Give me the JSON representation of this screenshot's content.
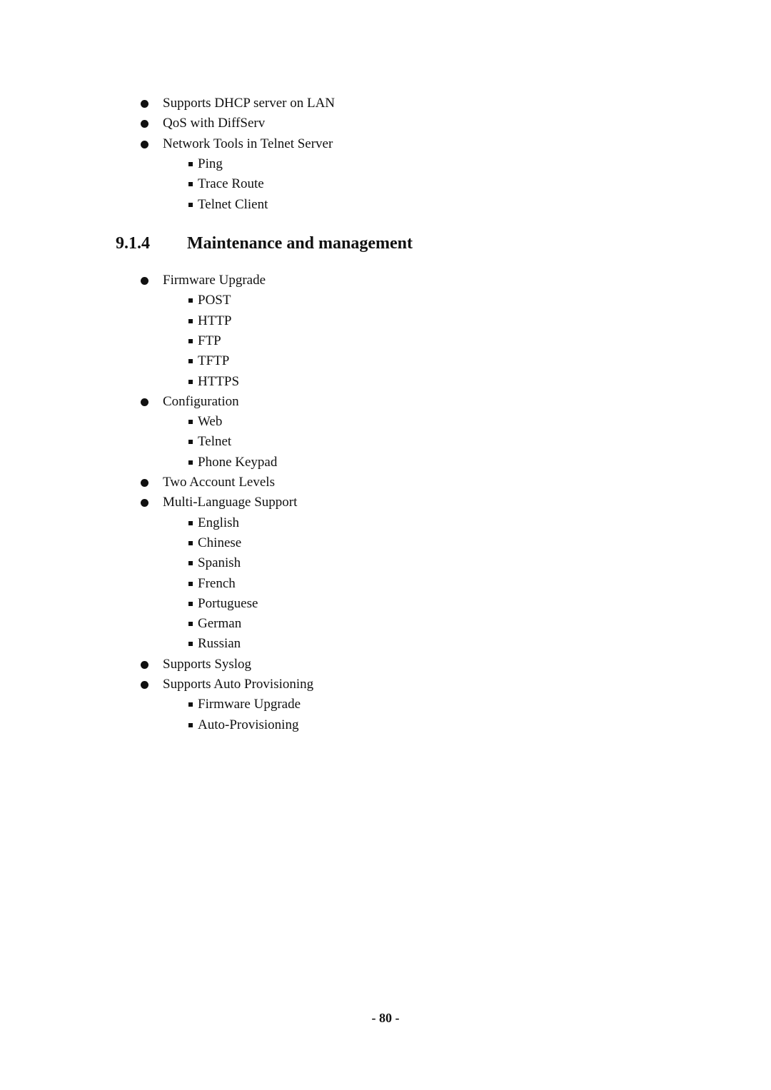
{
  "intro_list": [
    {
      "text": "Supports DHCP server on LAN",
      "subitems": []
    },
    {
      "text": "QoS with DiffServ",
      "subitems": []
    },
    {
      "text": "Network Tools in Telnet Server",
      "subitems": [
        "Ping",
        "Trace Route",
        "Telnet Client"
      ]
    }
  ],
  "section": {
    "number": "9.1.4",
    "title": "Maintenance and management"
  },
  "section_list": [
    {
      "text": "Firmware Upgrade",
      "subitems": [
        "POST",
        "HTTP",
        "FTP",
        "TFTP",
        "HTTPS"
      ]
    },
    {
      "text": "Configuration",
      "subitems": [
        "Web",
        "Telnet",
        "Phone Keypad"
      ]
    },
    {
      "text": "Two Account Levels",
      "subitems": []
    },
    {
      "text": "Multi-Language Support",
      "subitems": [
        "English",
        "Chinese",
        "Spanish",
        "French",
        "Portuguese",
        "German",
        "Russian"
      ]
    },
    {
      "text": "Supports Syslog",
      "subitems": []
    },
    {
      "text": "Supports Auto Provisioning",
      "subitems": [
        "Firmware Upgrade",
        "Auto-Provisioning"
      ]
    }
  ],
  "footer": {
    "page_number": "- 80 -"
  }
}
